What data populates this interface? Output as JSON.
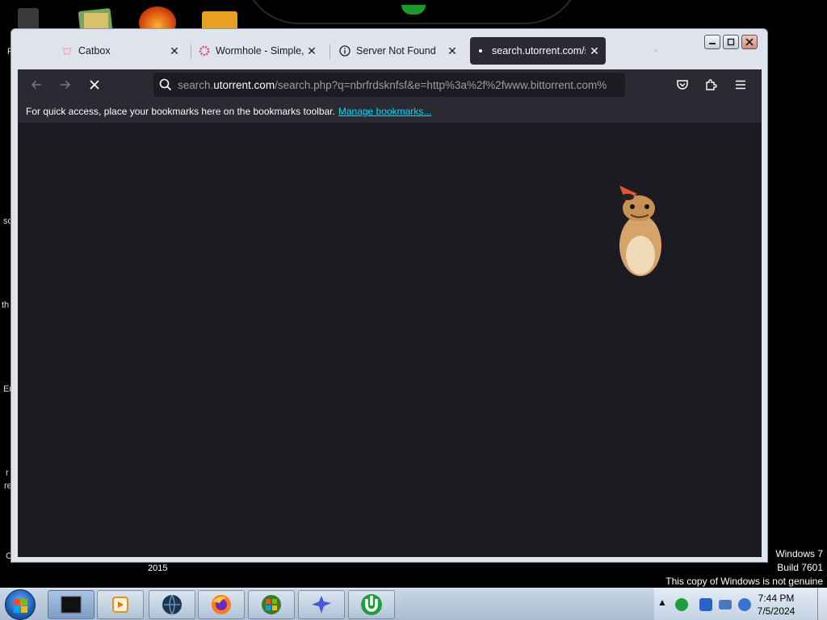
{
  "desktop": {
    "left_fragments": [
      "F",
      "sc",
      "th",
      "Er",
      "r",
      "re",
      "C"
    ],
    "year_label": "2015",
    "watermark": {
      "line1": "Windows 7",
      "line2": "Build 7601",
      "line3": "This copy of Windows is not genuine"
    }
  },
  "browser": {
    "tabs": [
      {
        "title": "Catbox",
        "favicon": "catbox-icon",
        "active": false
      },
      {
        "title": "Wormhole - Simple, p",
        "favicon": "wormhole-icon",
        "active": false
      },
      {
        "title": "Server Not Found",
        "favicon": "info-icon",
        "active": false
      },
      {
        "title": "search.utorrent.com/s",
        "favicon": "loading-dot-icon",
        "active": true
      }
    ],
    "url": {
      "prefix": "search.",
      "domain": "utorrent.com",
      "suffix": "/search.php?q=nbrfrdsknfsf&e=http%3a%2f%2fwww.bittorrent.com%"
    },
    "bookmarks_bar": {
      "message": "For quick access, place your bookmarks here on the bookmarks toolbar.",
      "link": "Manage bookmarks..."
    },
    "colors": {
      "chrome": "#2b2a33",
      "content": "#1c1b22",
      "link": "#00ddff"
    }
  },
  "taskbar": {
    "pinned": [
      "media-player-icon",
      "firefox-icon",
      "ie-icon",
      "bird-app-icon",
      "utorrent-icon"
    ],
    "clock": {
      "time": "7:44 PM",
      "date": "7/5/2024"
    }
  }
}
